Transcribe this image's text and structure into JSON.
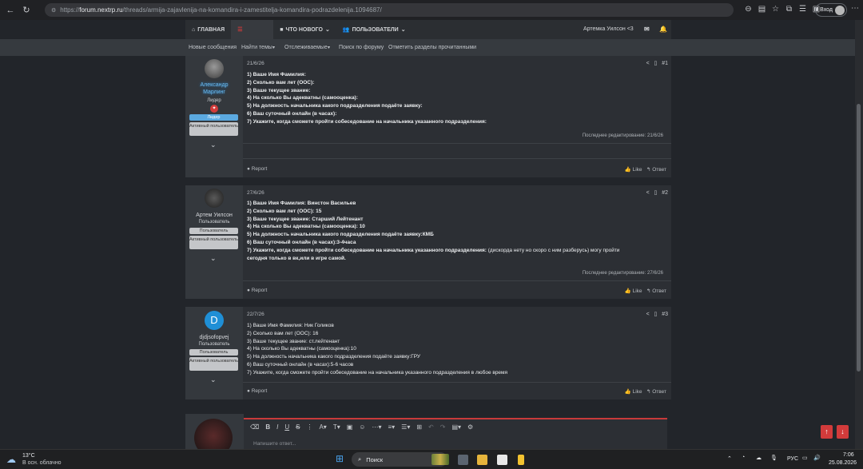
{
  "browser": {
    "url_prefix": "https://",
    "url_domain": "forum.nextrp.ru",
    "url_rest": "/threads/armija-zajavlenija-na-komandira-i-zamestitelja-komandira-podrazdelenija.1094687/",
    "login_label": "Вход"
  },
  "nav": {
    "home": "ГЛАВНАЯ",
    "forum": "",
    "whats_new": "ЧТО НОВОГО",
    "users": "ПОЛЬЗОВАТЕЛИ",
    "current_user": "Артемка Уилсон <3"
  },
  "subnav": {
    "new_posts": "Новые сообщения",
    "find_threads": "Найти темы",
    "watched": "Отслеживаемые",
    "search_forum": "Поиск по форуму",
    "mark_read": "Отметить разделы прочитанными"
  },
  "posts": [
    {
      "author": "Александр Марлинг",
      "author_line1": "Александр",
      "author_line2": "Марлинг",
      "title": "Лидер",
      "badges": [
        "Лидер",
        "Активный пользователь"
      ],
      "date": "21/6/26",
      "number": "#1",
      "lines": [
        {
          "q": "1) Ваше Имя Фамилия:",
          "a": ""
        },
        {
          "q": "2) Сколько вам лет (ООС):",
          "a": ""
        },
        {
          "q": "3) Ваше текущее звание:",
          "a": ""
        },
        {
          "q": "4) На сколько Вы адекватны (самооценка):",
          "a": ""
        },
        {
          "q": "5) На должность начальника какого подразделения подаёте заявку:",
          "a": ""
        },
        {
          "q": "6) Ваш суточный онлайн (в часах):",
          "a": ""
        },
        {
          "q": "7) Укажите, когда сможете пройти собеседование на начальника указанного подразделения:",
          "a": ""
        }
      ],
      "edited": "Последнее редактирование: 21/6/26"
    },
    {
      "author": "Артем Уилсон",
      "title": "Пользователь",
      "badges": [
        "Пользователь",
        "Активный пользователь"
      ],
      "date": "27/6/26",
      "number": "#2",
      "lines": [
        {
          "q": "1) Ваше Имя Фамилия:",
          "a": " Винстон Васильев"
        },
        {
          "q": "2) Сколько вам лет (ООС):",
          "a": " 15"
        },
        {
          "q": "3) Ваше текущее звание:",
          "a": " Старший Лейтенант"
        },
        {
          "q": "4) На сколько Вы адекватны (самооценка):",
          "a": " 10"
        },
        {
          "q": "5) На должность начальника какого подразделения подаёте заявку:",
          "a": "КМБ"
        },
        {
          "q": "6) Ваш суточный онлайн (в часах):",
          "a": "3-4часа"
        },
        {
          "q": "7) Укажите, когда сможете пройти собеседование на начальника указанного подразделения:",
          "a": " (дискорда нету но скоро с ним разберусь) могу пройти"
        },
        {
          "q": "",
          "a": "сегодня только в вк,или в игре самой."
        }
      ],
      "edited": "Последнее редактирование: 27/6/26"
    },
    {
      "author": "djdjsofopvej",
      "avatar_letter": "D",
      "title": "Пользователь",
      "badges": [
        "Пользователь",
        "Активный пользователь"
      ],
      "date": "22/7/26",
      "number": "#3",
      "lines": [
        {
          "q": "1) Ваше Имя Фамилия:",
          "a": " Ник Голиков"
        },
        {
          "q": "2) Сколько вам лет (ООС):",
          "a": " 16"
        },
        {
          "q": "3) Ваше текущее звание:",
          "a": " ст.лейтенант"
        },
        {
          "q": "4) На сколько Вы адекватны (самооценка):",
          "a": "10"
        },
        {
          "q": "5) На должность начальника какого подразделения подаёте заявку:",
          "a": "ГРУ"
        },
        {
          "q": "6) Ваш суточный онлайн (в часах):",
          "a": "5-6 часов"
        },
        {
          "q": "7) Укажите, когда сможете пройти собеседование на начальника указанного подразделения",
          "a": " в любое время"
        }
      ]
    }
  ],
  "actions": {
    "report": "Report",
    "like": "Like",
    "reply": "Ответ"
  },
  "editor": {
    "placeholder": "Напишите ответ..."
  },
  "taskbar": {
    "temp": "13°C",
    "weather": "В осн. облачно",
    "search": "Поиск",
    "lang": "РУС",
    "time": "7:06",
    "date": "25.08.2026"
  },
  "colors": {
    "accent": "#d23b3b",
    "leader_badge": "#5ba9e0",
    "avatar_d": "#1f8fd6"
  }
}
